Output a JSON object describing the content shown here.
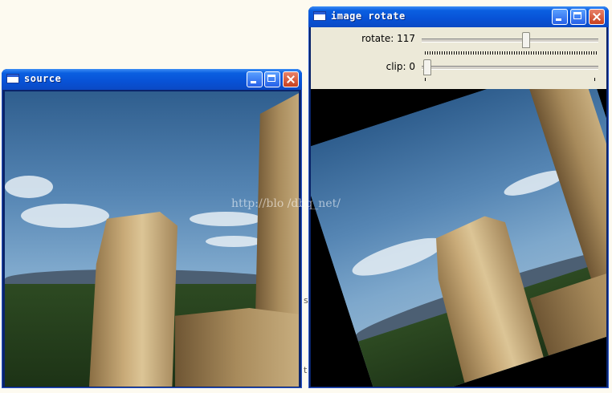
{
  "windows": {
    "source": {
      "title": "source"
    },
    "rotate": {
      "title": "image rotate"
    }
  },
  "controls": {
    "rotate": {
      "label": "rotate: 117",
      "value": 117
    },
    "clip": {
      "label": "clip: 0",
      "value": 0
    }
  },
  "watermark": "http://blo    /dbq_net/",
  "background_fragments": [
    "s",
    "t"
  ],
  "icons": [
    "window-icon",
    "minimize-icon",
    "maximize-icon",
    "close-icon"
  ],
  "colors": {
    "titlebar": "#0852d6",
    "close": "#c8401e",
    "dialog": "#ece9d8"
  }
}
